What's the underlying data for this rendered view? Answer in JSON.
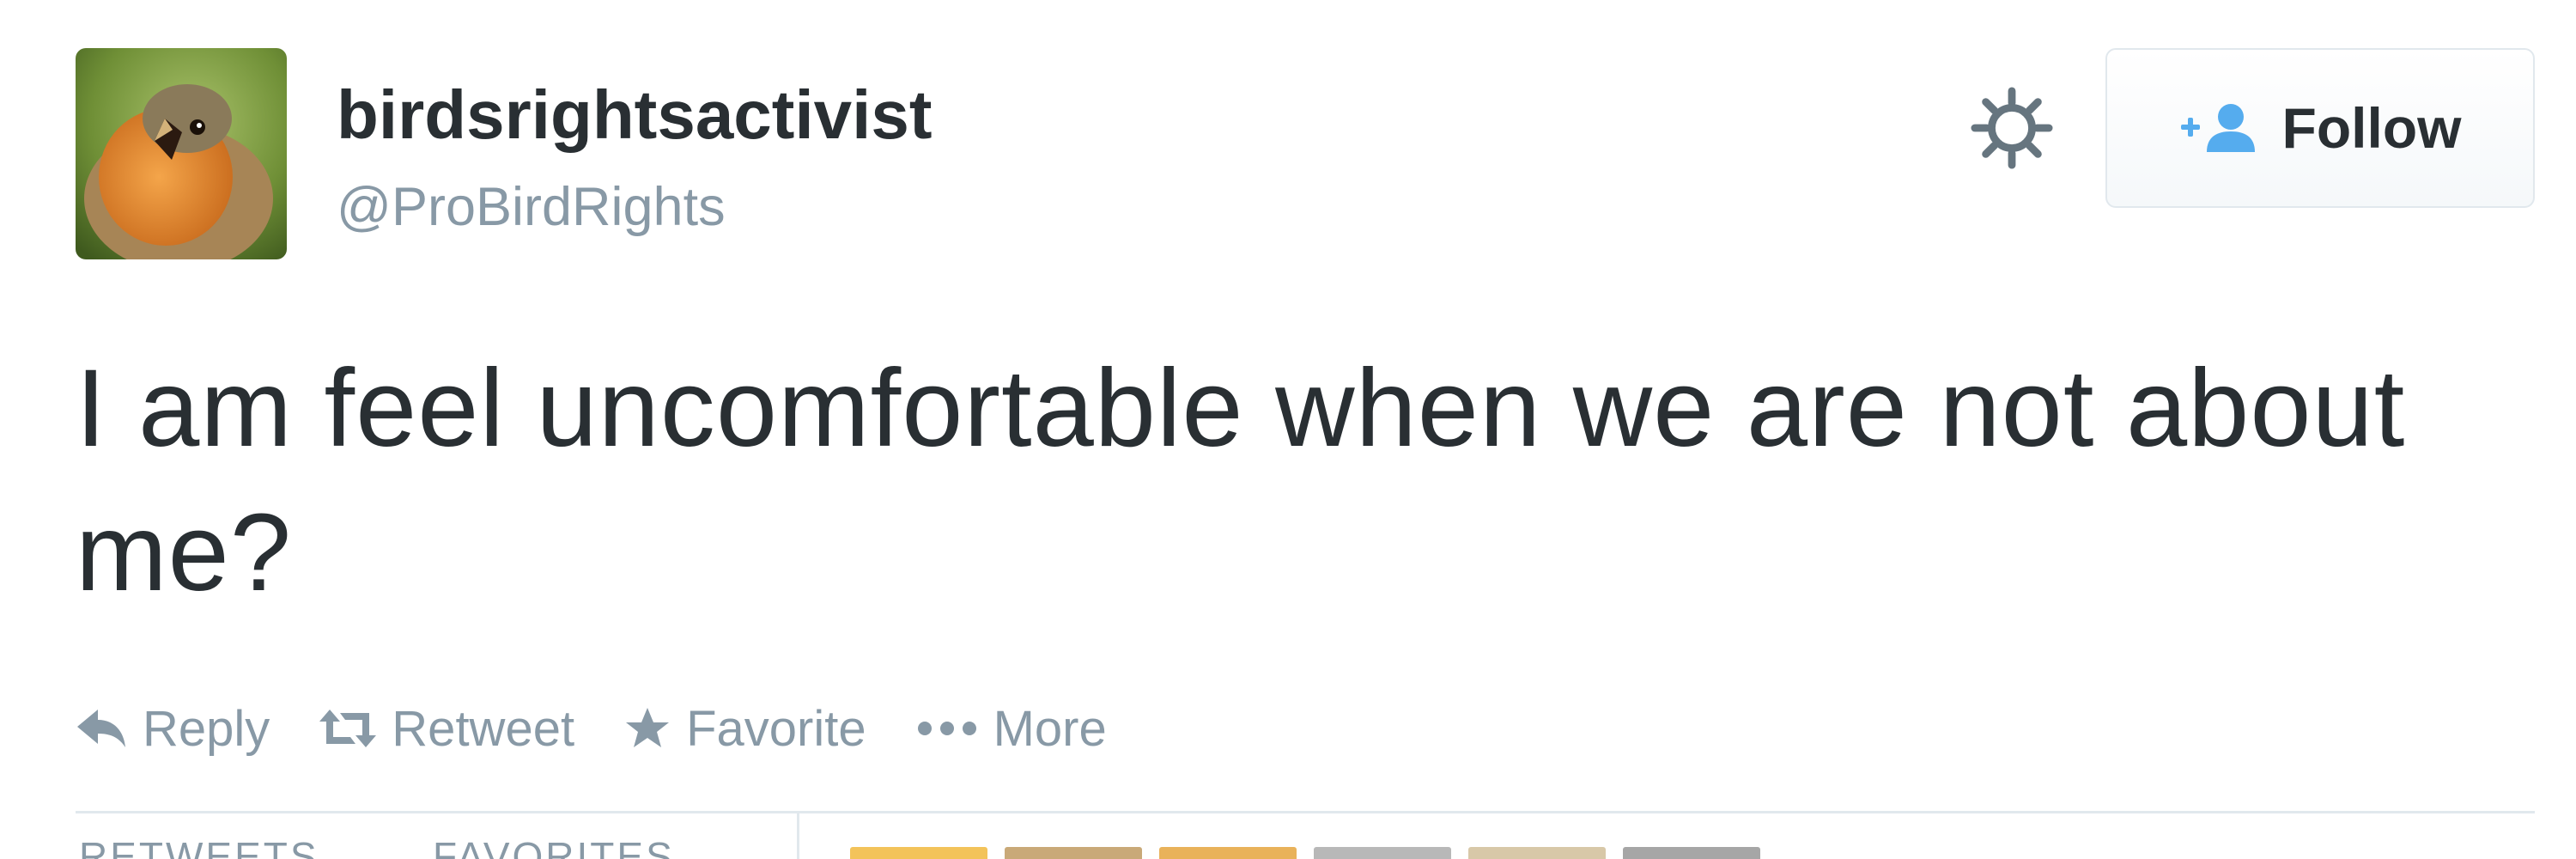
{
  "user": {
    "display_name": "birdsrightsactivist",
    "handle": "@ProBirdRights",
    "avatar_icon": "robin-avatar"
  },
  "header": {
    "gear_icon": "gear-icon",
    "follow_label": "Follow",
    "follow_icon": "add-user-icon"
  },
  "tweet": {
    "text": "I am feel uncomfortable when we are not about me?"
  },
  "actions": {
    "reply": "Reply",
    "retweet": "Retweet",
    "favorite": "Favorite",
    "more": "More"
  },
  "stats": {
    "retweets_label": "RETWEETS",
    "favorites_label": "FAVORITES"
  },
  "colors": {
    "text": "#292f33",
    "muted": "#8899a6",
    "follow_icon": "#55acee",
    "divider": "#e1e8ed"
  }
}
